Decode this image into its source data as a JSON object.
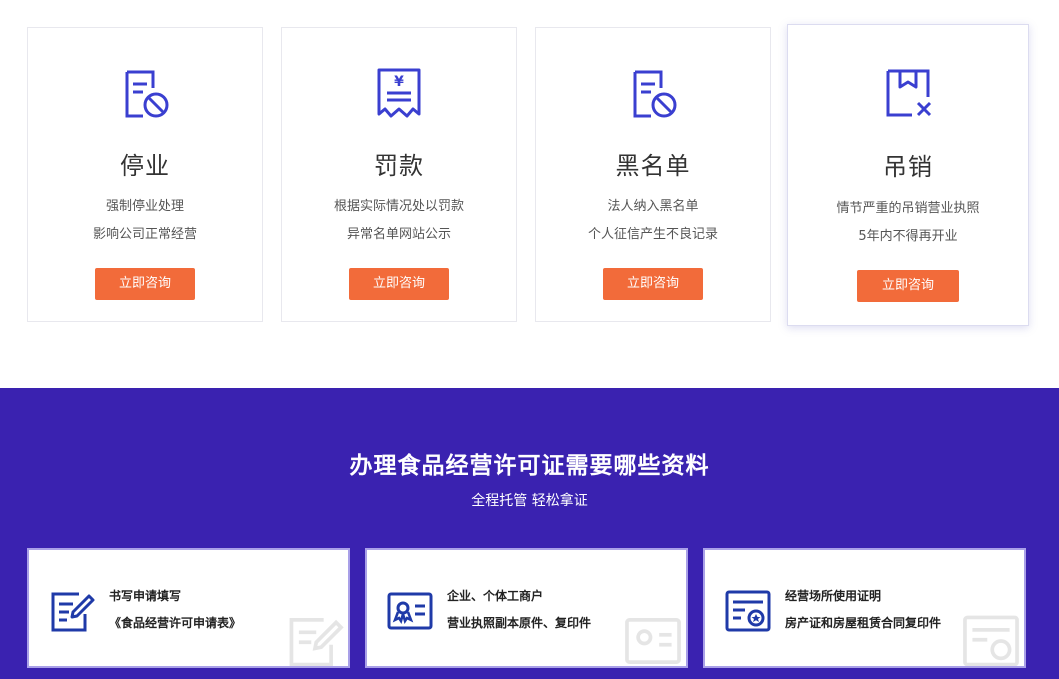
{
  "colors": {
    "icon_blue": "#3a3fd0",
    "button_orange": "#f26b3a",
    "section_purple": "#3a22b0",
    "doc_icon_blue": "#1f3aa8"
  },
  "consequences": [
    {
      "icon": "document-prohibited-icon",
      "title": "停业",
      "line1": "强制停业处理",
      "line2": "影响公司正常经营",
      "button": "立即咨询"
    },
    {
      "icon": "receipt-yen-icon",
      "title": "罚款",
      "line1": "根据实际情况处以罚款",
      "line2": "异常名单网站公示",
      "button": "立即咨询"
    },
    {
      "icon": "document-prohibited-icon",
      "title": "黑名单",
      "line1": "法人纳入黑名单",
      "line2": "个人征信产生不良记录",
      "button": "立即咨询"
    },
    {
      "icon": "box-cancel-icon",
      "title": "吊销",
      "line1": "情节严重的吊销营业执照",
      "line2": "5年内不得再开业",
      "button": "立即咨询"
    }
  ],
  "materials": {
    "heading": "办理食品经营许可证需要哪些资料",
    "subheading": "全程托管 轻松拿证",
    "items": [
      {
        "icon": "form-edit-icon",
        "line1": "书写申请填写",
        "line2": "《食品经营许可申请表》"
      },
      {
        "icon": "id-card-icon",
        "line1": "企业、个体工商户",
        "line2": "营业执照副本原件、复印件"
      },
      {
        "icon": "certificate-icon",
        "line1": "经营场所使用证明",
        "line2": "房产证和房屋租赁合同复印件"
      }
    ]
  }
}
